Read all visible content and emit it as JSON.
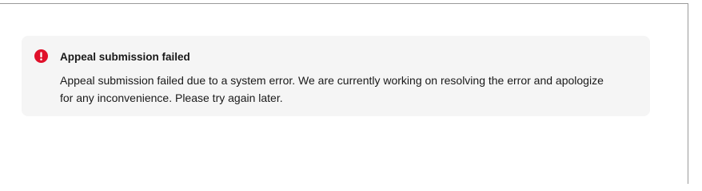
{
  "alert": {
    "icon": "error-icon",
    "icon_color": "#e0102a",
    "background": "#f5f5f5",
    "title": "Appeal submission failed",
    "message": "Appeal submission failed due to a system error. We are currently working on resolving the error and apologize for any inconvenience. Please try again later."
  }
}
